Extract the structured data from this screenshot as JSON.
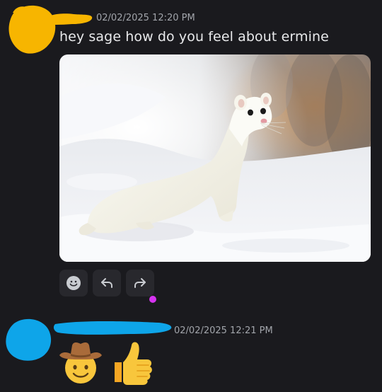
{
  "message1": {
    "timestamp": "02/02/2025 12:20 PM",
    "text": "hey sage how do you feel about ermine",
    "attachment_alt": "white ermine standing in snow",
    "actions": [
      {
        "icon": "smiley-icon"
      },
      {
        "icon": "reply-icon"
      },
      {
        "icon": "forward-icon"
      }
    ]
  },
  "message2": {
    "timestamp": "02/02/2025 12:21 PM",
    "emojis": [
      "cowboy-face-emoji",
      "thumbs-up-emoji"
    ]
  },
  "colors": {
    "background": "#1a1a1e",
    "avatar1": "#f7b500",
    "avatar2": "#0ea5e9",
    "status_dot": "#d633f0",
    "timestamp": "#a2a5ab"
  }
}
